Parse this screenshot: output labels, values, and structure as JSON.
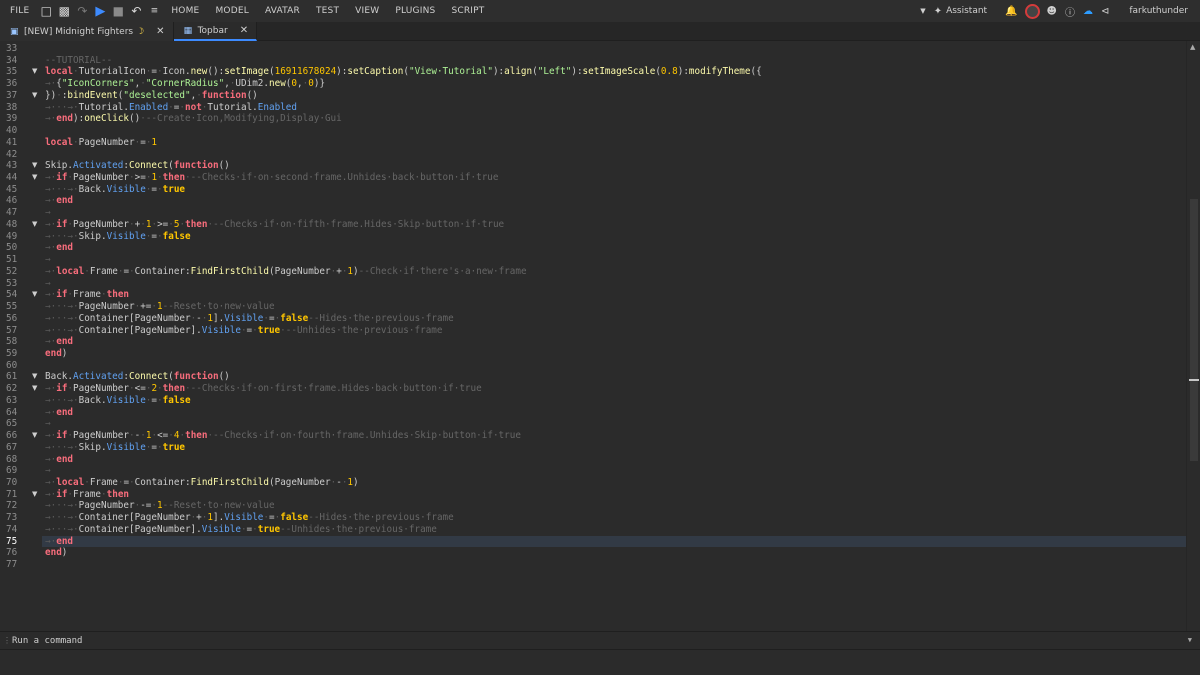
{
  "menubar": {
    "file": "FILE",
    "menus": [
      "HOME",
      "MODEL",
      "AVATAR",
      "TEST",
      "VIEW",
      "PLUGINS",
      "SCRIPT"
    ],
    "assistant": "Assistant",
    "username": "farkuthunder"
  },
  "tabs": [
    {
      "label": "[NEW] Midnight Fighters",
      "moon": "☽"
    },
    {
      "label": "Topbar"
    }
  ],
  "command": {
    "placeholder": "Run a command"
  },
  "editor": {
    "first_line": 33,
    "current_line": 75,
    "fold_lines": [
      35,
      37,
      43,
      44,
      48,
      54,
      61,
      62,
      66,
      71
    ],
    "lines": [
      [],
      [
        [
          "c",
          "--TUTORIAL--"
        ]
      ],
      [
        [
          "k",
          "local"
        ],
        [
          "d",
          "·"
        ],
        [
          "t",
          "TutorialIcon"
        ],
        [
          "d",
          "·"
        ],
        [
          "t",
          "="
        ],
        [
          "d",
          "·"
        ],
        [
          "t",
          "Icon."
        ],
        [
          "f",
          "new"
        ],
        [
          "t",
          "():"
        ],
        [
          "f",
          "setImage"
        ],
        [
          "t",
          "("
        ],
        [
          "n",
          "16911678024"
        ],
        [
          "t",
          "):"
        ],
        [
          "f",
          "setCaption"
        ],
        [
          "t",
          "("
        ],
        [
          "s",
          "\"View·Tutorial\""
        ],
        [
          "t",
          "):"
        ],
        [
          "f",
          "align"
        ],
        [
          "t",
          "("
        ],
        [
          "s",
          "\"Left\""
        ],
        [
          "t",
          "):"
        ],
        [
          "f",
          "setImageScale"
        ],
        [
          "t",
          "("
        ],
        [
          "n",
          "0.8"
        ],
        [
          "t",
          "):"
        ],
        [
          "f",
          "modifyTheme"
        ],
        [
          "t",
          "({"
        ]
      ],
      [
        [
          "d",
          "→"
        ],
        [
          "d",
          "·"
        ],
        [
          "t",
          "{"
        ],
        [
          "s",
          "\"IconCorners\""
        ],
        [
          "t",
          ","
        ],
        [
          "d",
          "·"
        ],
        [
          "s",
          "\"CornerRadius\""
        ],
        [
          "t",
          ","
        ],
        [
          "d",
          "·"
        ],
        [
          "t",
          "UDim2."
        ],
        [
          "f",
          "new"
        ],
        [
          "t",
          "("
        ],
        [
          "n",
          "0"
        ],
        [
          "t",
          ","
        ],
        [
          "d",
          "·"
        ],
        [
          "n",
          "0"
        ],
        [
          "t",
          ")}"
        ]
      ],
      [
        [
          "t",
          "})"
        ],
        [
          "d",
          "·"
        ],
        [
          "t",
          ":"
        ],
        [
          "f",
          "bindEvent"
        ],
        [
          "t",
          "("
        ],
        [
          "s",
          "\"deselected\""
        ],
        [
          "t",
          ","
        ],
        [
          "d",
          "·"
        ],
        [
          "k",
          "function"
        ],
        [
          "t",
          "()"
        ]
      ],
      [
        [
          "d",
          "→"
        ],
        [
          "d",
          "···→"
        ],
        [
          "d",
          "·"
        ],
        [
          "t",
          "Tutorial."
        ],
        [
          "p",
          "Enabled"
        ],
        [
          "d",
          "·"
        ],
        [
          "t",
          "="
        ],
        [
          "d",
          "·"
        ],
        [
          "k",
          "not"
        ],
        [
          "d",
          "·"
        ],
        [
          "t",
          "Tutorial."
        ],
        [
          "p",
          "Enabled"
        ]
      ],
      [
        [
          "d",
          "→"
        ],
        [
          "d",
          "·"
        ],
        [
          "k",
          "end"
        ],
        [
          "t",
          ")"
        ],
        [
          "t",
          ":"
        ],
        [
          "f",
          "oneClick"
        ],
        [
          "t",
          "()"
        ],
        [
          "d",
          "·"
        ],
        [
          "c",
          "--Create·Icon,Modifying,Display·Gui"
        ]
      ],
      [],
      [
        [
          "k",
          "local"
        ],
        [
          "d",
          "·"
        ],
        [
          "t",
          "PageNumber"
        ],
        [
          "d",
          "·"
        ],
        [
          "t",
          "="
        ],
        [
          "d",
          "·"
        ],
        [
          "n",
          "1"
        ]
      ],
      [],
      [
        [
          "t",
          "Skip."
        ],
        [
          "p",
          "Activated"
        ],
        [
          "t",
          ":"
        ],
        [
          "f",
          "Connect"
        ],
        [
          "t",
          "("
        ],
        [
          "k",
          "function"
        ],
        [
          "t",
          "()"
        ]
      ],
      [
        [
          "d",
          "→"
        ],
        [
          "d",
          "·"
        ],
        [
          "k",
          "if"
        ],
        [
          "d",
          "·"
        ],
        [
          "t",
          "PageNumber"
        ],
        [
          "d",
          "·"
        ],
        [
          "t",
          ">="
        ],
        [
          "d",
          "·"
        ],
        [
          "n",
          "1"
        ],
        [
          "d",
          "·"
        ],
        [
          "k",
          "then"
        ],
        [
          "d",
          "·"
        ],
        [
          "c",
          "--Checks·if·on·second·frame.Unhides·back·button·if·true"
        ]
      ],
      [
        [
          "d",
          "→"
        ],
        [
          "d",
          "···→"
        ],
        [
          "d",
          "·"
        ],
        [
          "t",
          "Back."
        ],
        [
          "p",
          "Visible"
        ],
        [
          "d",
          "·"
        ],
        [
          "t",
          "="
        ],
        [
          "d",
          "·"
        ],
        [
          "kb",
          "true"
        ]
      ],
      [
        [
          "d",
          "→"
        ],
        [
          "d",
          "·"
        ],
        [
          "k",
          "end"
        ]
      ],
      [
        [
          "d",
          "→"
        ]
      ],
      [
        [
          "d",
          "→"
        ],
        [
          "d",
          "·"
        ],
        [
          "k",
          "if"
        ],
        [
          "d",
          "·"
        ],
        [
          "t",
          "PageNumber"
        ],
        [
          "d",
          "·"
        ],
        [
          "t",
          "+"
        ],
        [
          "d",
          "·"
        ],
        [
          "n",
          "1"
        ],
        [
          "d",
          "·"
        ],
        [
          "t",
          ">="
        ],
        [
          "d",
          "·"
        ],
        [
          "n",
          "5"
        ],
        [
          "d",
          "·"
        ],
        [
          "k",
          "then"
        ],
        [
          "d",
          "·"
        ],
        [
          "c",
          "--Checks·if·on·fifth·frame.Hides·Skip·button·if·true"
        ]
      ],
      [
        [
          "d",
          "→"
        ],
        [
          "d",
          "···→"
        ],
        [
          "d",
          "·"
        ],
        [
          "t",
          "Skip."
        ],
        [
          "p",
          "Visible"
        ],
        [
          "d",
          "·"
        ],
        [
          "t",
          "="
        ],
        [
          "d",
          "·"
        ],
        [
          "kb",
          "false"
        ]
      ],
      [
        [
          "d",
          "→"
        ],
        [
          "d",
          "·"
        ],
        [
          "k",
          "end"
        ]
      ],
      [
        [
          "d",
          "→"
        ]
      ],
      [
        [
          "d",
          "→"
        ],
        [
          "d",
          "·"
        ],
        [
          "k",
          "local"
        ],
        [
          "d",
          "·"
        ],
        [
          "t",
          "Frame"
        ],
        [
          "d",
          "·"
        ],
        [
          "t",
          "="
        ],
        [
          "d",
          "·"
        ],
        [
          "t",
          "Container:"
        ],
        [
          "f",
          "FindFirstChild"
        ],
        [
          "t",
          "(PageNumber"
        ],
        [
          "d",
          "·"
        ],
        [
          "t",
          "+"
        ],
        [
          "d",
          "·"
        ],
        [
          "n",
          "1"
        ],
        [
          "t",
          ")"
        ],
        [
          "c",
          "--Check·if·there's·a·new·frame"
        ]
      ],
      [
        [
          "d",
          "→"
        ]
      ],
      [
        [
          "d",
          "→"
        ],
        [
          "d",
          "·"
        ],
        [
          "k",
          "if"
        ],
        [
          "d",
          "·"
        ],
        [
          "t",
          "Frame"
        ],
        [
          "d",
          "·"
        ],
        [
          "k",
          "then"
        ]
      ],
      [
        [
          "d",
          "→"
        ],
        [
          "d",
          "···→"
        ],
        [
          "d",
          "·"
        ],
        [
          "t",
          "PageNumber"
        ],
        [
          "d",
          "·"
        ],
        [
          "t",
          "+="
        ],
        [
          "d",
          "·"
        ],
        [
          "n",
          "1"
        ],
        [
          "c",
          "--Reset·to·new·value"
        ]
      ],
      [
        [
          "d",
          "→"
        ],
        [
          "d",
          "···→"
        ],
        [
          "d",
          "·"
        ],
        [
          "t",
          "Container[PageNumber"
        ],
        [
          "d",
          "·"
        ],
        [
          "t",
          "-"
        ],
        [
          "d",
          "·"
        ],
        [
          "n",
          "1"
        ],
        [
          "t",
          "]."
        ],
        [
          "p",
          "Visible"
        ],
        [
          "d",
          "·"
        ],
        [
          "t",
          "="
        ],
        [
          "d",
          "·"
        ],
        [
          "kb",
          "false"
        ],
        [
          "c",
          "--Hides·the·previous·frame"
        ]
      ],
      [
        [
          "d",
          "→"
        ],
        [
          "d",
          "···→"
        ],
        [
          "d",
          "·"
        ],
        [
          "t",
          "Container[PageNumber]."
        ],
        [
          "p",
          "Visible"
        ],
        [
          "d",
          "·"
        ],
        [
          "t",
          "="
        ],
        [
          "d",
          "·"
        ],
        [
          "kb",
          "true"
        ],
        [
          "d",
          "·"
        ],
        [
          "c",
          "--Unhides·the·previous·frame"
        ]
      ],
      [
        [
          "d",
          "→"
        ],
        [
          "d",
          "·"
        ],
        [
          "k",
          "end"
        ]
      ],
      [
        [
          "k",
          "end"
        ],
        [
          "t",
          ")"
        ]
      ],
      [],
      [
        [
          "t",
          "Back."
        ],
        [
          "p",
          "Activated"
        ],
        [
          "t",
          ":"
        ],
        [
          "f",
          "Connect"
        ],
        [
          "t",
          "("
        ],
        [
          "k",
          "function"
        ],
        [
          "t",
          "()"
        ]
      ],
      [
        [
          "d",
          "→"
        ],
        [
          "d",
          "·"
        ],
        [
          "k",
          "if"
        ],
        [
          "d",
          "·"
        ],
        [
          "t",
          "PageNumber"
        ],
        [
          "d",
          "·"
        ],
        [
          "t",
          "<="
        ],
        [
          "d",
          "·"
        ],
        [
          "n",
          "2"
        ],
        [
          "d",
          "·"
        ],
        [
          "k",
          "then"
        ],
        [
          "d",
          "·"
        ],
        [
          "c",
          "--Checks·if·on·first·frame.Hides·back·button·if·true"
        ]
      ],
      [
        [
          "d",
          "→"
        ],
        [
          "d",
          "···→"
        ],
        [
          "d",
          "·"
        ],
        [
          "t",
          "Back."
        ],
        [
          "p",
          "Visible"
        ],
        [
          "d",
          "·"
        ],
        [
          "t",
          "="
        ],
        [
          "d",
          "·"
        ],
        [
          "kb",
          "false"
        ]
      ],
      [
        [
          "d",
          "→"
        ],
        [
          "d",
          "·"
        ],
        [
          "k",
          "end"
        ]
      ],
      [
        [
          "d",
          "→"
        ]
      ],
      [
        [
          "d",
          "→"
        ],
        [
          "d",
          "·"
        ],
        [
          "k",
          "if"
        ],
        [
          "d",
          "·"
        ],
        [
          "t",
          "PageNumber"
        ],
        [
          "d",
          "·"
        ],
        [
          "t",
          "-"
        ],
        [
          "d",
          "·"
        ],
        [
          "n",
          "1"
        ],
        [
          "d",
          "·"
        ],
        [
          "t",
          "<="
        ],
        [
          "d",
          "·"
        ],
        [
          "n",
          "4"
        ],
        [
          "d",
          "·"
        ],
        [
          "k",
          "then"
        ],
        [
          "d",
          "·"
        ],
        [
          "c",
          "--Checks·if·on·fourth·frame.Unhides·Skip·button·if·true"
        ]
      ],
      [
        [
          "d",
          "→"
        ],
        [
          "d",
          "···→"
        ],
        [
          "d",
          "·"
        ],
        [
          "t",
          "Skip."
        ],
        [
          "p",
          "Visible"
        ],
        [
          "d",
          "·"
        ],
        [
          "t",
          "="
        ],
        [
          "d",
          "·"
        ],
        [
          "kb",
          "true"
        ]
      ],
      [
        [
          "d",
          "→"
        ],
        [
          "d",
          "·"
        ],
        [
          "k",
          "end"
        ]
      ],
      [
        [
          "d",
          "→"
        ]
      ],
      [
        [
          "d",
          "→"
        ],
        [
          "d",
          "·"
        ],
        [
          "k",
          "local"
        ],
        [
          "d",
          "·"
        ],
        [
          "t",
          "Frame"
        ],
        [
          "d",
          "·"
        ],
        [
          "t",
          "="
        ],
        [
          "d",
          "·"
        ],
        [
          "t",
          "Container:"
        ],
        [
          "f",
          "FindFirstChild"
        ],
        [
          "t",
          "(PageNumber"
        ],
        [
          "d",
          "·"
        ],
        [
          "t",
          "-"
        ],
        [
          "d",
          "·"
        ],
        [
          "n",
          "1"
        ],
        [
          "t",
          ")"
        ]
      ],
      [
        [
          "d",
          "→"
        ],
        [
          "d",
          "·"
        ],
        [
          "k",
          "if"
        ],
        [
          "d",
          "·"
        ],
        [
          "t",
          "Frame"
        ],
        [
          "d",
          "·"
        ],
        [
          "k",
          "then"
        ]
      ],
      [
        [
          "d",
          "→"
        ],
        [
          "d",
          "···→"
        ],
        [
          "d",
          "·"
        ],
        [
          "t",
          "PageNumber"
        ],
        [
          "d",
          "·"
        ],
        [
          "t",
          "-="
        ],
        [
          "d",
          "·"
        ],
        [
          "n",
          "1"
        ],
        [
          "c",
          "--Reset·to·new·value"
        ]
      ],
      [
        [
          "d",
          "→"
        ],
        [
          "d",
          "···→"
        ],
        [
          "d",
          "·"
        ],
        [
          "t",
          "Container[PageNumber"
        ],
        [
          "d",
          "·"
        ],
        [
          "t",
          "+"
        ],
        [
          "d",
          "·"
        ],
        [
          "n",
          "1"
        ],
        [
          "t",
          "]."
        ],
        [
          "p",
          "Visible"
        ],
        [
          "d",
          "·"
        ],
        [
          "t",
          "="
        ],
        [
          "d",
          "·"
        ],
        [
          "kb",
          "false"
        ],
        [
          "c",
          "--Hides·the·previous·frame"
        ]
      ],
      [
        [
          "d",
          "→"
        ],
        [
          "d",
          "···→"
        ],
        [
          "d",
          "·"
        ],
        [
          "t",
          "Container[PageNumber]."
        ],
        [
          "p",
          "Visible"
        ],
        [
          "d",
          "·"
        ],
        [
          "t",
          "="
        ],
        [
          "d",
          "·"
        ],
        [
          "kb",
          "true"
        ],
        [
          "c",
          "--Unhides·the·previous·frame"
        ]
      ],
      [
        [
          "d",
          "→"
        ],
        [
          "d",
          "·"
        ],
        [
          "k",
          "end"
        ]
      ],
      [
        [
          "k",
          "end"
        ],
        [
          "t",
          ")"
        ]
      ],
      []
    ]
  }
}
